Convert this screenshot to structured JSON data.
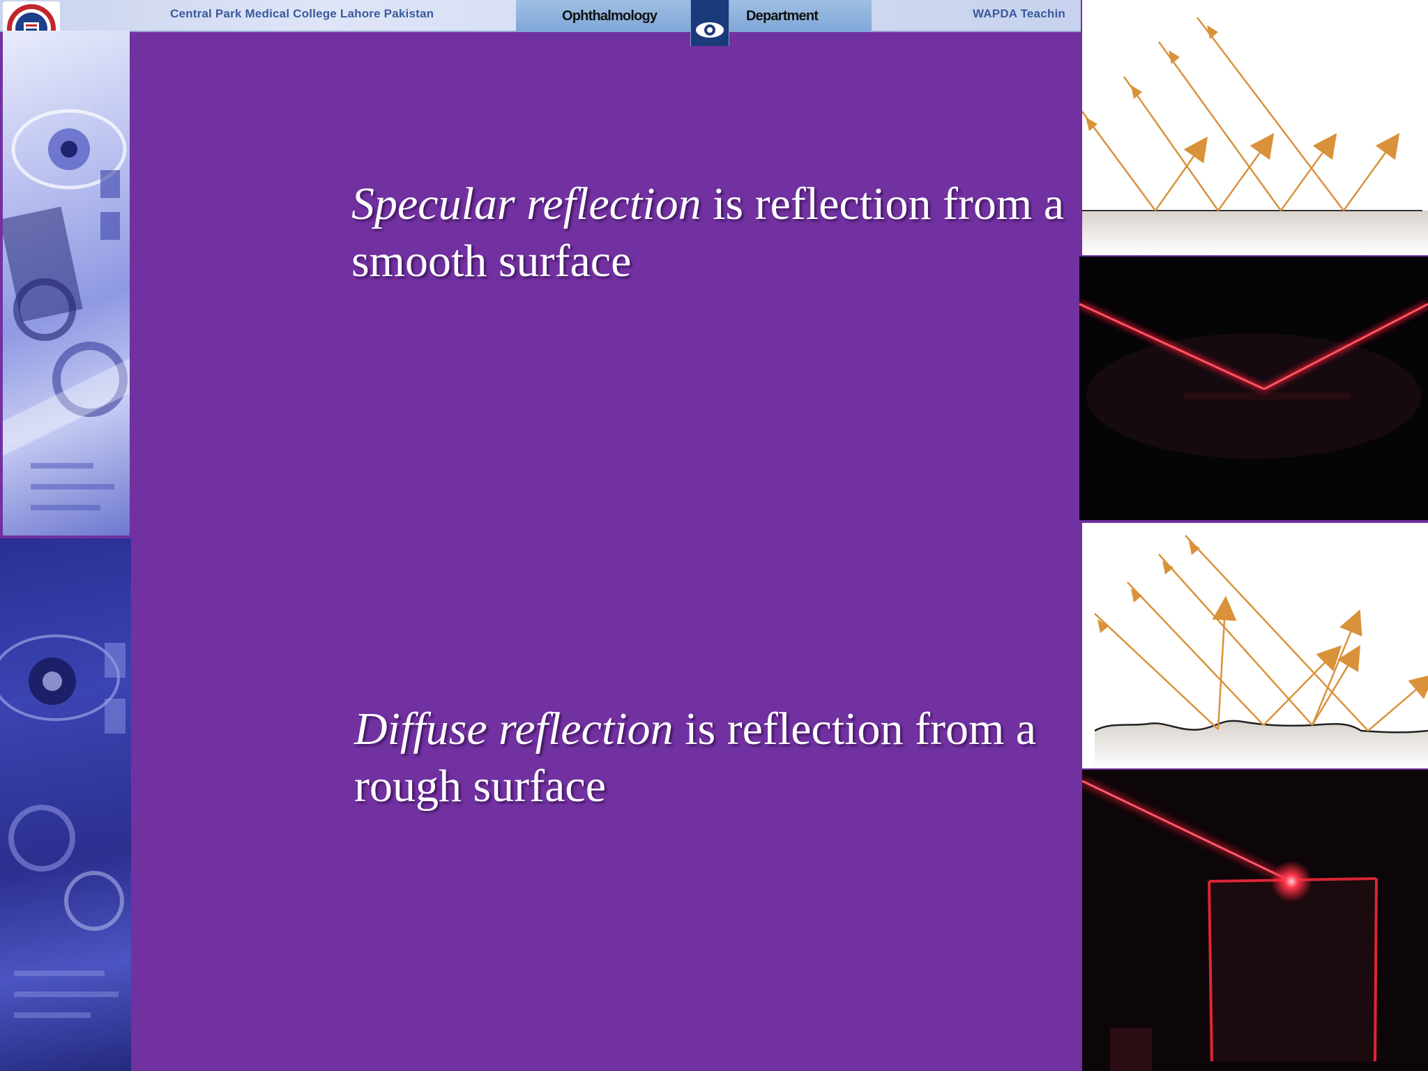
{
  "header": {
    "college_name": "Central Park Medical College Lahore  Pakistan",
    "department_left": "Ophthalmology",
    "department_right": "Department",
    "teaching_hospital": "WAPDA Teachin"
  },
  "logo": {
    "icon": "college-seal-icon"
  },
  "paragraphs": {
    "specular": {
      "term": "Specular reflection",
      "rest": " is reflection from a smooth surface"
    },
    "diffuse": {
      "term": "Diffuse reflection",
      "rest": " is reflection from a rough surface"
    }
  },
  "figures": {
    "specular_diagram": {
      "icon": "specular-reflection-diagram-icon"
    },
    "specular_photo": {
      "icon": "laser-mirror-reflection-photo-icon"
    },
    "diffuse_diagram": {
      "icon": "diffuse-reflection-diagram-icon"
    },
    "diffuse_photo": {
      "icon": "laser-rough-surface-photo-icon"
    }
  },
  "colors": {
    "background": "#7131a0",
    "text": "#ffffff",
    "ray": "#d9923a",
    "laser": "#ff2a3c",
    "banner_text": "#3a5a9c"
  }
}
